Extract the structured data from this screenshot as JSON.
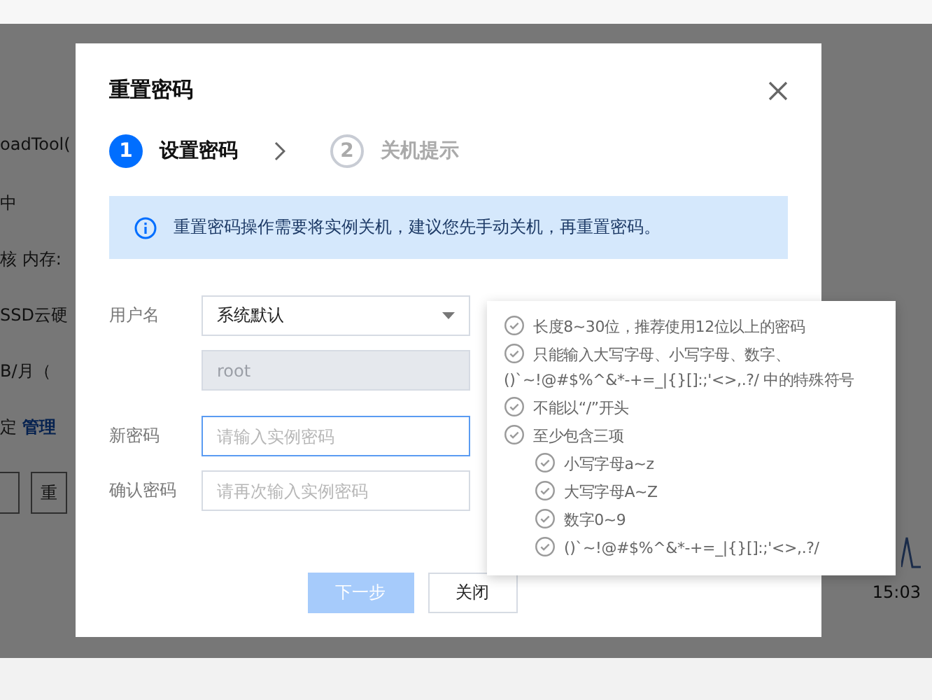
{
  "background_page": {
    "texts": [
      {
        "kind": "text",
        "text": "oadTool("
      },
      {
        "kind": "text",
        "text": "中"
      },
      {
        "kind": "text",
        "text": "核 内存:"
      },
      {
        "kind": "text",
        "text": "SSD云硬"
      },
      {
        "kind": "text",
        "text": "B/月（"
      },
      {
        "kind": "link",
        "text": "定",
        "link": "管理"
      }
    ],
    "button_label": "重",
    "time": "15:03"
  },
  "dialog": {
    "title": "重置密码",
    "steps": [
      {
        "number": "1",
        "label": "设置密码",
        "selected": true
      },
      {
        "number": "2",
        "label": "关机提示",
        "selected": false
      }
    ],
    "alert": "重置密码操作需要将实例关机，建议您先手动关机，再重置密码。",
    "form": [
      {
        "kind": "select",
        "label": "用户名",
        "value": "系统默认"
      },
      {
        "kind": "readonly",
        "value": "root"
      },
      {
        "kind": "input",
        "label": "新密码",
        "placeholder": "请输入实例密码",
        "focused": true
      },
      {
        "kind": "input",
        "label": "确认密码",
        "placeholder": "请再次输入实例密码",
        "focused": false
      }
    ],
    "buttons": [
      {
        "label": "下一步",
        "kind": "primary",
        "disabled": true
      },
      {
        "label": "关闭",
        "kind": "default",
        "disabled": false
      }
    ]
  },
  "password_rules": [
    {
      "text": "长度8~30位，推荐使用12位以上的密码"
    },
    {
      "text": "只能输入大写字母、小写字母、数字、()`~!@#$%^&*-+=_|{}[]:;'<>,.?/ 中的特殊符号"
    },
    {
      "text": "不能以“/”开头"
    },
    {
      "text": "至少包含三项",
      "children": [
        {
          "text": "小写字母a~z"
        },
        {
          "text": "大写字母A~Z"
        },
        {
          "text": "数字0~9"
        },
        {
          "text": "()`~!@#$%^&*-+=_|{}[]:;'<>,.?/"
        }
      ]
    }
  ]
}
